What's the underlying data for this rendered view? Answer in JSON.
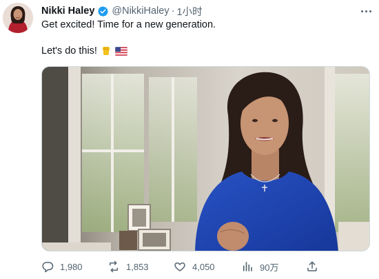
{
  "tweet": {
    "author": {
      "name": "Nikki Haley",
      "handle": "@NikkiHaley",
      "verified": true,
      "verified_color": "#1d9bf0"
    },
    "separator": "·",
    "time": "1小时",
    "text_line1": "Get excited! Time for a new generation.",
    "text_line2": "Let's do this!",
    "emojis": [
      "raised-fist",
      "us-flag"
    ],
    "media": {
      "type": "video-still"
    },
    "actions": {
      "replies": "1,980",
      "retweets": "1,853",
      "likes": "4,050",
      "views": "90万"
    }
  },
  "colors": {
    "text": "#0f1419",
    "secondary": "#536471",
    "accent": "#1d9bf0",
    "dress": "#1f48b3"
  }
}
